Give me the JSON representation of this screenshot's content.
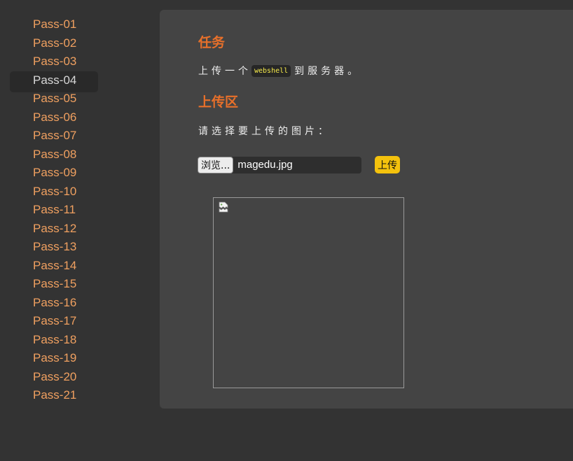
{
  "sidebar": {
    "items": [
      {
        "label": "Pass-01"
      },
      {
        "label": "Pass-02"
      },
      {
        "label": "Pass-03"
      },
      {
        "label": "Pass-04",
        "active": true
      },
      {
        "label": "Pass-05"
      },
      {
        "label": "Pass-06"
      },
      {
        "label": "Pass-07"
      },
      {
        "label": "Pass-08"
      },
      {
        "label": "Pass-09"
      },
      {
        "label": "Pass-10"
      },
      {
        "label": "Pass-11"
      },
      {
        "label": "Pass-12"
      },
      {
        "label": "Pass-13"
      },
      {
        "label": "Pass-14"
      },
      {
        "label": "Pass-15"
      },
      {
        "label": "Pass-16"
      },
      {
        "label": "Pass-17"
      },
      {
        "label": "Pass-18"
      },
      {
        "label": "Pass-19"
      },
      {
        "label": "Pass-20"
      },
      {
        "label": "Pass-21"
      }
    ]
  },
  "task": {
    "title": "任务",
    "text_before": "上传一个",
    "code": "webshell",
    "text_after": "到服务器。"
  },
  "upload": {
    "title": "上传区",
    "prompt": "请选择要上传的图片：",
    "browse_label": "浏览...",
    "file_name": "magedu.jpg",
    "submit_label": "上传"
  },
  "preview": {
    "icon": "broken-image-icon"
  },
  "colors": {
    "accent": "#e8702a",
    "nav_link": "#f0a060",
    "button": "#f4c20d",
    "code_text": "#f5e94a"
  }
}
